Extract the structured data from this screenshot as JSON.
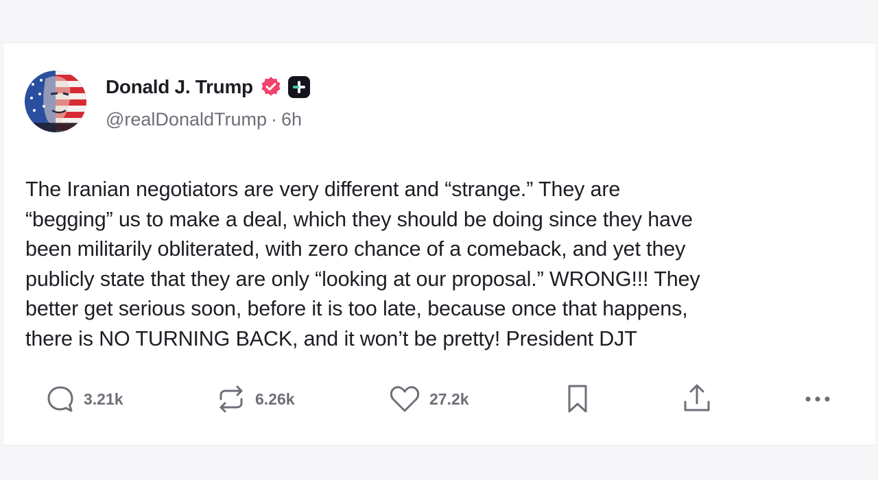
{
  "post": {
    "author": {
      "display_name": "Donald J. Trump",
      "handle": "@realDonaldTrump",
      "avatar_icon": "flag-portrait-avatar",
      "verified_icon": "verified-check-icon",
      "plus_icon": "plus-badge-icon",
      "verified_color": "#f0436b"
    },
    "separator": "·",
    "time": "6h",
    "text": "The Iranian negotiators are very different and “strange.” They are\n“begging” us to make a deal, which they should be doing since they have\nbeen militarily obliterated, with zero chance of a comeback, and yet they\npublicly state that they are only “looking at our proposal.” WRONG!!! They\nbetter get serious soon, before it is too late, because once that happens,\nthere is NO TURNING BACK, and it won’t be pretty! President DJT",
    "actions": {
      "replies": {
        "icon": "reply-icon",
        "count": "3.21k"
      },
      "reposts": {
        "icon": "repost-icon",
        "count": "6.26k"
      },
      "likes": {
        "icon": "heart-icon",
        "count": "27.2k"
      },
      "bookmark": {
        "icon": "bookmark-icon"
      },
      "share": {
        "icon": "share-icon"
      },
      "more": {
        "icon": "more-icon"
      }
    }
  }
}
